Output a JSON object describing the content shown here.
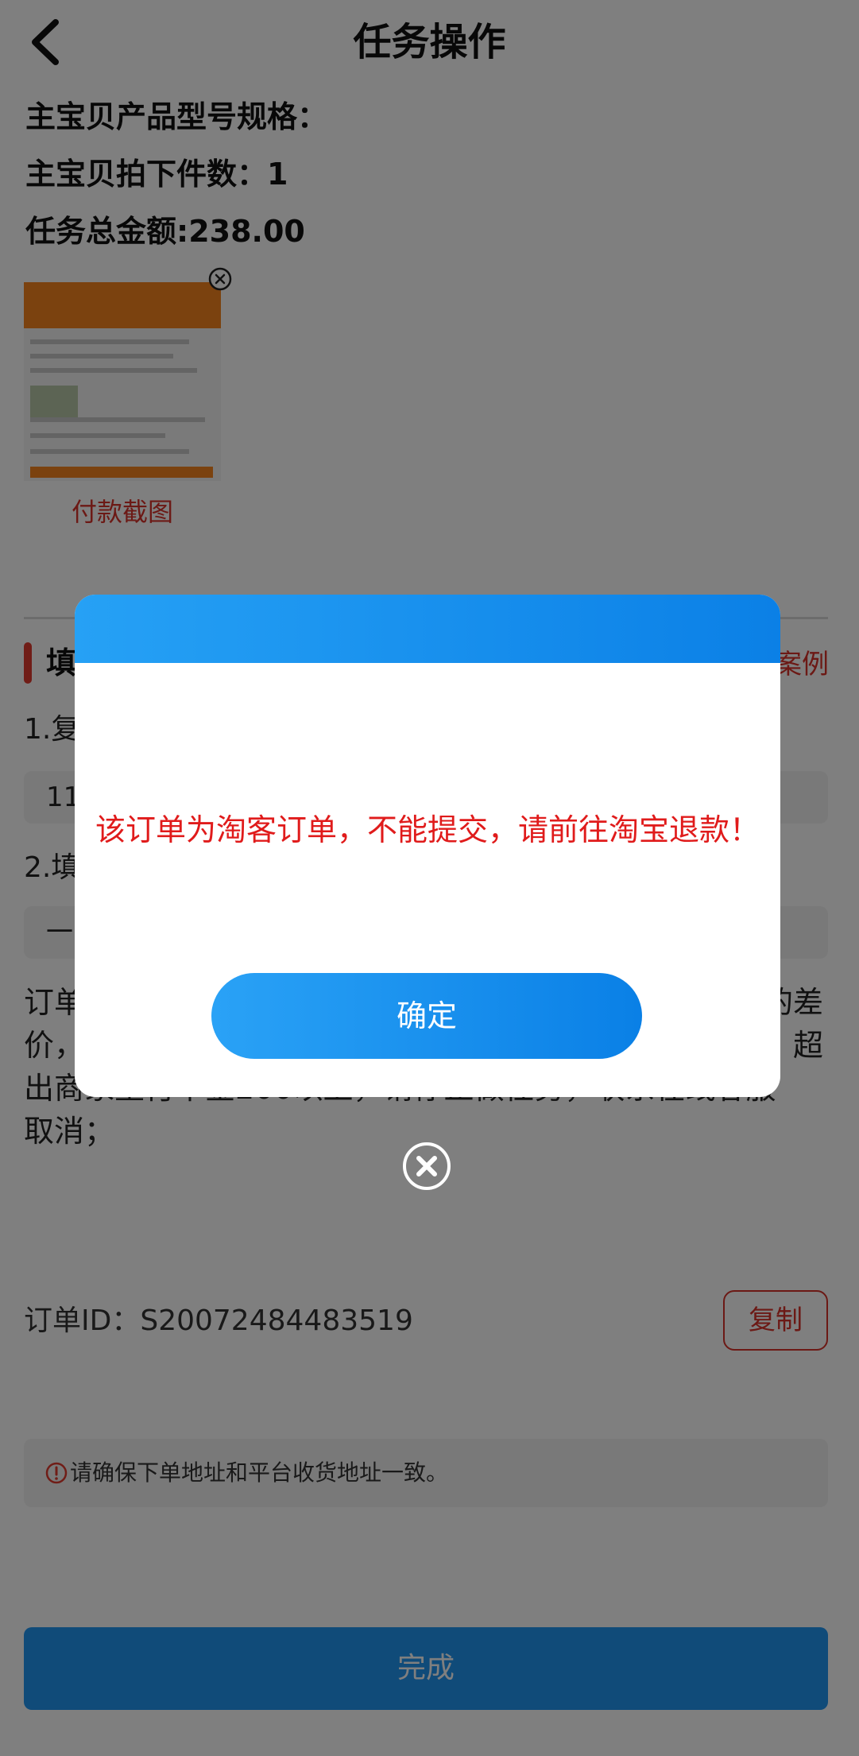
{
  "header": {
    "title": "任务操作",
    "back_icon": "chevron-left-icon"
  },
  "task_info": {
    "spec_line": "主宝贝产品型号规格：",
    "quantity_line": "主宝贝拍下件数：1",
    "amount_line": "任务总金额:238.00"
  },
  "payment_screenshot": {
    "caption": "付款截图",
    "remove_icon": "close-circle-icon"
  },
  "section": {
    "title": "填",
    "link": "案例"
  },
  "steps": {
    "step1_label": "1.复",
    "step1_value": "11",
    "step2_label": "2.填",
    "step2_value": "一"
  },
  "notice": {
    "line1_start": "订单",
    "line1_end": "的差",
    "line2_start": "价，",
    "line2_end": "超",
    "line3": "出商家垫付本金200以上，请停止做任务，联系在线客服",
    "line4": "取消；"
  },
  "order": {
    "id_text": "订单ID：S20072484483519",
    "copy_label": "复制"
  },
  "tip": {
    "icon": "warning-circle-icon",
    "text": "请确保下单地址和平台收货地址一致。"
  },
  "footer": {
    "finish_label": "完成"
  },
  "dialog": {
    "message": "该订单为淘客订单，不能提交，请前往淘宝退款！",
    "confirm_label": "确定",
    "close_icon": "close-circle-icon"
  },
  "colors": {
    "accent_blue": "#0b80e6",
    "alert_red": "#e01b1b",
    "link_red": "#d8332a",
    "overlay": "rgba(0,0,0,0.5)"
  }
}
